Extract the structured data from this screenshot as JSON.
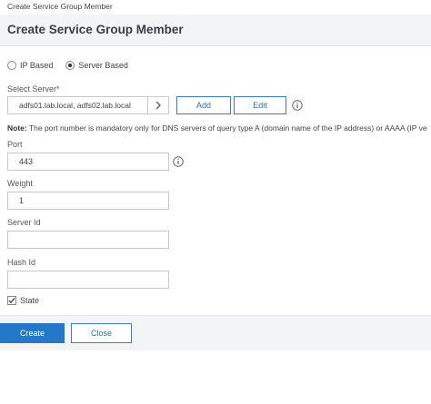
{
  "window_title": "Create Service Group Member",
  "header": {
    "title": "Create Service Group Member"
  },
  "radio": {
    "ip_based": "IP Based",
    "server_based": "Server Based",
    "selected": "server_based"
  },
  "select_server": {
    "label": "Select Server*",
    "value": "adfs01.lab.local, adfs02.lab.local",
    "add_label": "Add",
    "edit_label": "Edit"
  },
  "note": {
    "prefix": "Note:",
    "text": " The port number is mandatory only for DNS servers of query type A (domain name of the IP address) or AAAA (IP ve"
  },
  "port": {
    "label": "Port",
    "value": "443"
  },
  "weight": {
    "label": "Weight",
    "value": "1"
  },
  "server_id": {
    "label": "Server Id",
    "value": ""
  },
  "hash_id": {
    "label": "Hash Id",
    "value": ""
  },
  "state": {
    "label": "State",
    "checked": true
  },
  "footer": {
    "create_label": "Create",
    "close_label": "Close"
  },
  "colors": {
    "primary": "#2478c7",
    "outline": "#3b7fc4",
    "header_bg": "#f3f4f6"
  }
}
